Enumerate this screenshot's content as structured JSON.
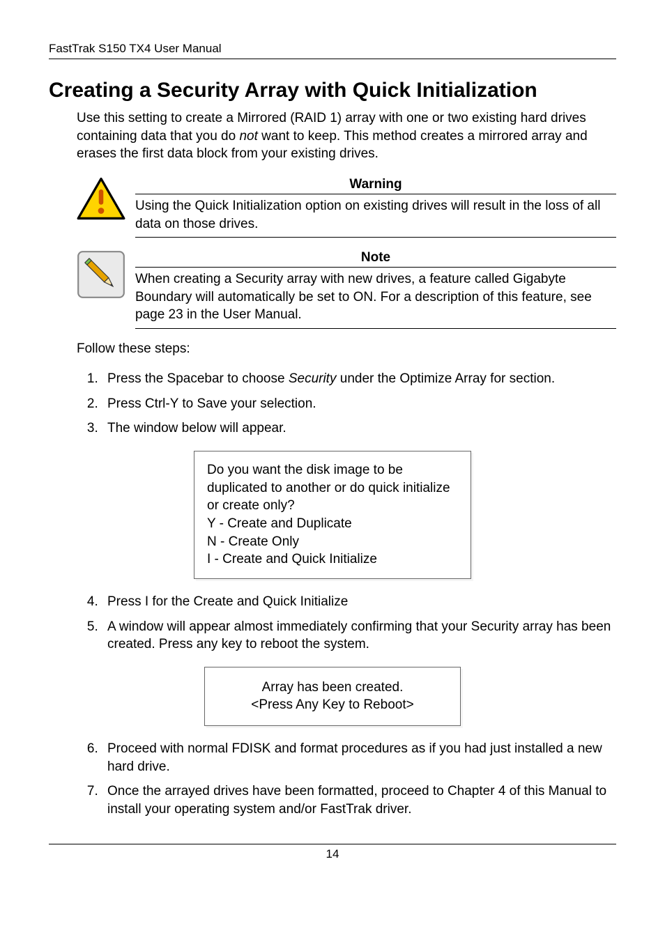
{
  "header": "FastTrak S150 TX4 User Manual",
  "title": "Creating a Security Array with Quick Initialization",
  "intro_pre": "Use this setting to create a Mirrored (RAID 1) array with one or two existing hard drives containing data that you do ",
  "intro_italic": "not",
  "intro_post": " want to keep. This method creates a mirrored array and erases the first data block from your existing drives.",
  "warning": {
    "title": "Warning",
    "text": "Using the Quick Initialization option on existing drives will result in the loss of all data on those drives."
  },
  "note": {
    "title": "Note",
    "text": "When creating a Security array with new drives, a feature called Gigabyte Boundary will automatically be set to ON. For a description of this feature, see page 23 in the User Manual."
  },
  "follow": "Follow these steps:",
  "steps": {
    "s1_pre": "Press the Spacebar to choose ",
    "s1_italic": "Security",
    "s1_post": " under the Optimize Array for section.",
    "s2": "Press Ctrl-Y to Save your selection.",
    "s3": "The window below will appear.",
    "s4": "Press I for the Create and Quick Initialize",
    "s5": "A window will appear almost immediately confirming that your Security array has been created. Press any key to reboot the system.",
    "s6": "Proceed with normal FDISK and format procedures as if you had just installed a new hard drive.",
    "s7": "Once the arrayed drives have been formatted, proceed to Chapter 4 of this Manual to install your operating system and/or FastTrak driver."
  },
  "dialog1": {
    "q": "Do you want the disk image to be duplicated to another or do quick initialize or create only?",
    "opt1": "Y - Create and Duplicate",
    "opt2": "N - Create Only",
    "opt3": " I  - Create and Quick Initialize"
  },
  "dialog2": {
    "line1": "Array has been created.",
    "line2": "<Press Any Key to Reboot>"
  },
  "pagenum": "14"
}
